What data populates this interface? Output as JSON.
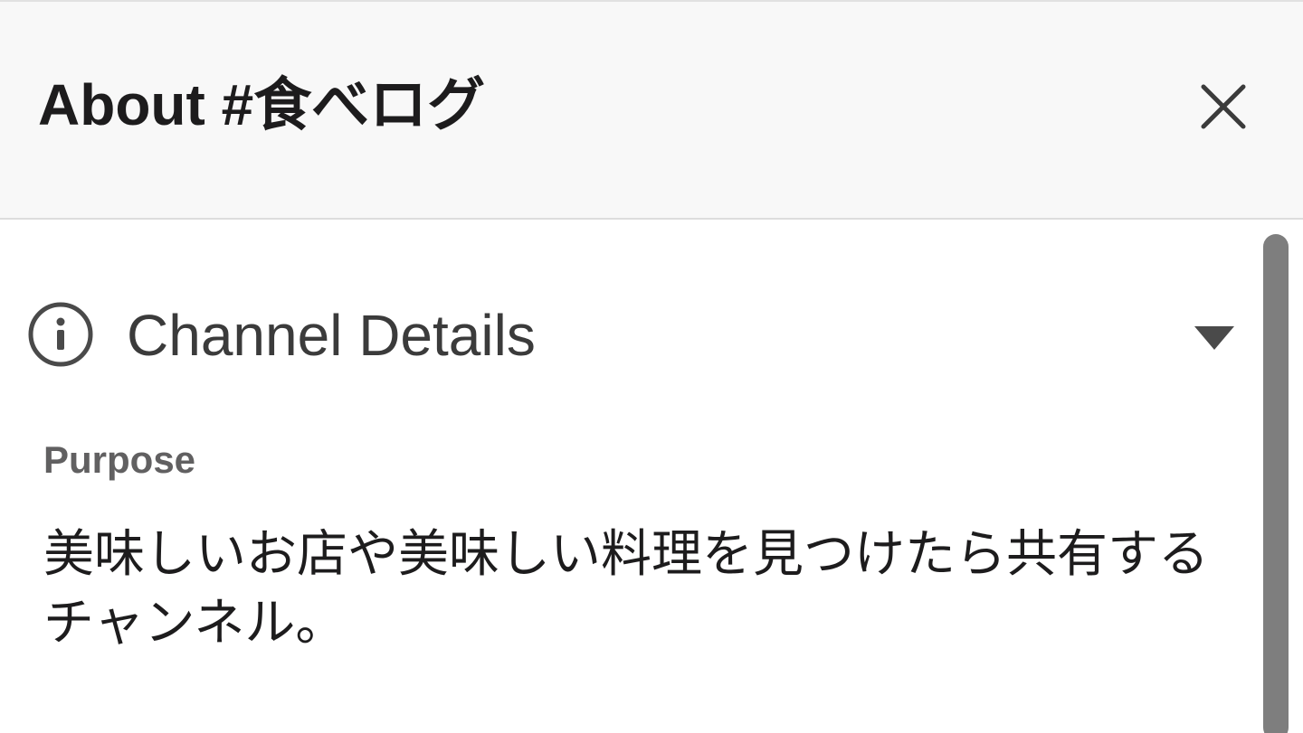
{
  "header": {
    "title": "About #食べログ",
    "close_icon": "close-icon"
  },
  "channel_details": {
    "icon": "info-icon",
    "title": "Channel Details",
    "toggle_icon": "caret-down-icon",
    "expanded": true
  },
  "purpose": {
    "label": "Purpose",
    "text": "美味しいお店や美味しい料理を見つけたら共有するチャンネル。"
  },
  "colors": {
    "header_bg": "#f8f8f8",
    "title_text": "#1d1c1d",
    "muted_text": "#616061",
    "scrollbar": "#7e7e7e"
  }
}
